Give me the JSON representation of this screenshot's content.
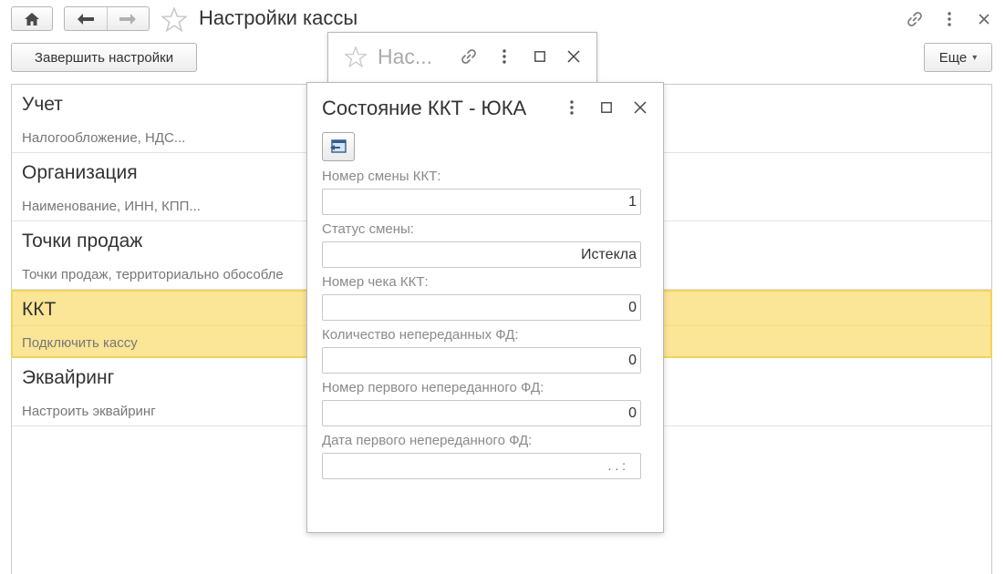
{
  "app": {
    "title": "Настройки кассы"
  },
  "toolbar": {
    "finish_label": "Завершить настройки",
    "more_label": "Еще",
    "more_caret": "▾"
  },
  "sections": [
    {
      "title": "Учет",
      "desc": "Налогообложение, НДС..."
    },
    {
      "title": "Организация",
      "desc": "Наименование, ИНН, КПП..."
    },
    {
      "title": "Точки продаж",
      "desc": "Точки продаж, территориально обособле"
    },
    {
      "title": "ККТ",
      "desc": "Подключить кассу",
      "active": true
    },
    {
      "title": "Эквайринг",
      "desc": "Настроить эквайринг"
    }
  ],
  "back_window": {
    "title": "Нас..."
  },
  "dialog": {
    "title": "Состояние ККТ - ЮКА",
    "fields": [
      {
        "label": "Номер смены ККТ:",
        "value": "1"
      },
      {
        "label": "Статус смены:",
        "value": "Истекла"
      },
      {
        "label": "Номер чека ККТ:",
        "value": "0"
      },
      {
        "label": "Количество непереданных ФД:",
        "value": "0"
      },
      {
        "label": "Номер первого непереданного ФД:",
        "value": "0"
      },
      {
        "label": "Дата первого непереданного ФД:",
        "value": ". .  :"
      }
    ]
  },
  "colors": {
    "active_bg": "#fbe596",
    "active_border": "#f2d35a"
  },
  "icons": {
    "home": "home-icon",
    "back": "arrow-left-icon",
    "forward": "arrow-right-icon",
    "favorite": "star-icon",
    "link": "link-icon",
    "more": "kebab-menu-icon",
    "close": "close-icon",
    "maximize": "maximize-icon",
    "refresh": "refresh-icon"
  }
}
